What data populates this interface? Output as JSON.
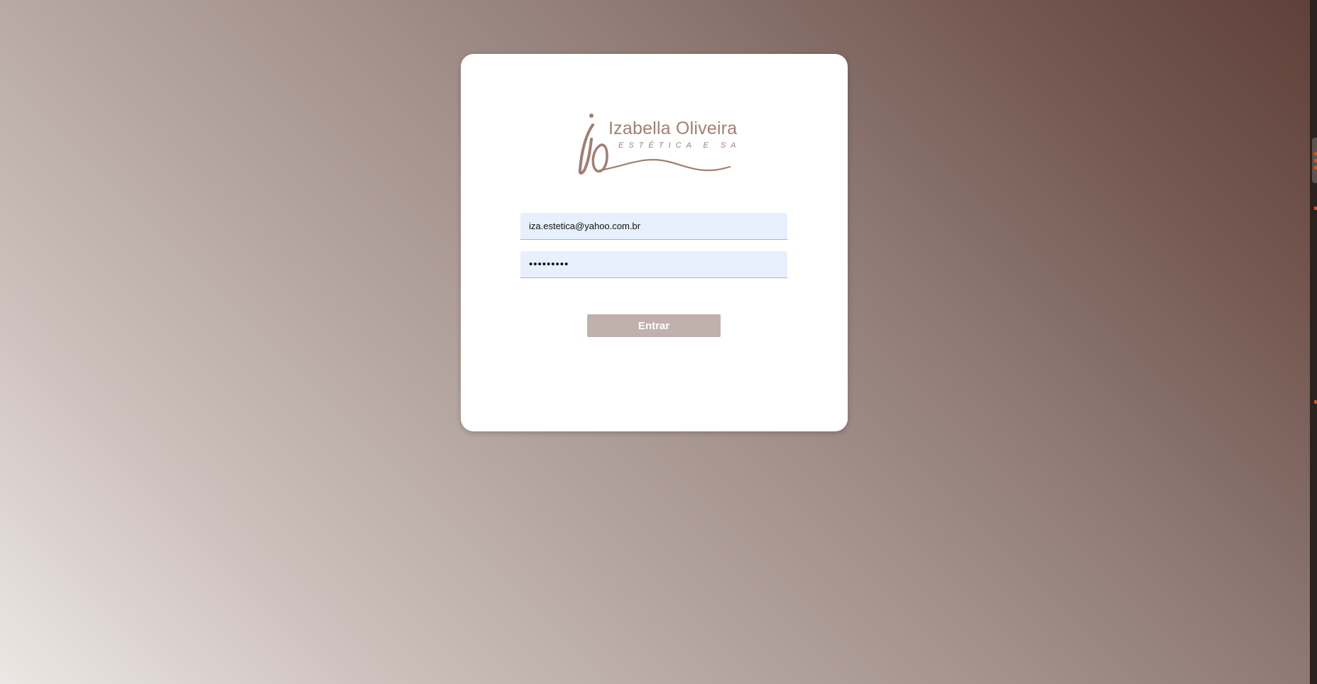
{
  "brand": {
    "name": "Izabella Oliveira",
    "tagline": "ESTÉTICA E SAÚDE",
    "monogram": "io",
    "color": "#a27e72"
  },
  "login": {
    "email_value": "iza.estetica@yahoo.com.br",
    "password_value": "•••••••••",
    "submit_label": "Entrar"
  },
  "colors": {
    "field_background": "#e8f0fe",
    "button_background": "#c0b1ad",
    "scroll_marker": "#e0521f"
  },
  "icons": {
    "scroll_markers": "scroll-marker-icon"
  }
}
